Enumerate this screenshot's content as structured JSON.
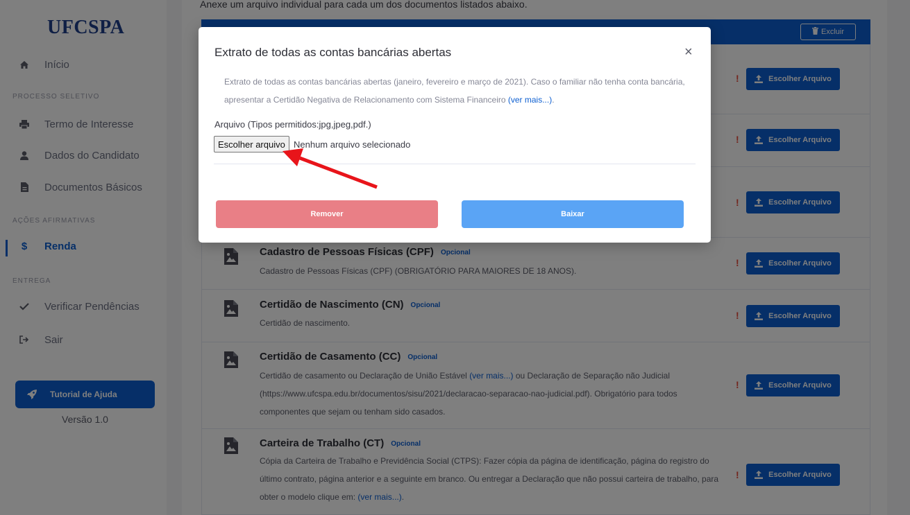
{
  "sidebar": {
    "brand": "UFCSPA",
    "home_label": "Início",
    "section_processo": "PROCESSO SELETIVO",
    "termo_label": "Termo de Interesse",
    "dados_label": "Dados do Candidato",
    "documentos_label": "Documentos Básicos",
    "section_acoes": "AÇÕES AFIRMATIVAS",
    "renda_label": "Renda",
    "section_entrega": "ENTREGA",
    "verificar_label": "Verificar Pendências",
    "sair_label": "Sair",
    "help_label": "Tutorial de Ajuda",
    "version": "Versão 1.0"
  },
  "main": {
    "intro": "Anexe um arquivo individual para cada um dos documentos listados abaixo.",
    "excluir_label": "Excluir",
    "optional_badge": "Opcional",
    "choose_label": "Escolher Arquivo",
    "warn_mark": "!",
    "docs": [
      {
        "title": "Cadastro de Pessoas Físicas (CPF)",
        "desc": "Cadastro de Pessoas Físicas (CPF) (OBRIGATÓRIO PARA MAIORES DE 18 ANOS)."
      },
      {
        "title": "Certidão de Nascimento (CN)",
        "desc": "Certidão de nascimento."
      },
      {
        "title": "Certidão de Casamento (CC)",
        "desc_a": "Certidão de casamento ou Declaração de União Estável ",
        "link": "(ver mais...)",
        "desc_b": " ou Declaração de Separação não Judicial (https://www.ufcspa.edu.br/documentos/sisu/2021/declaracao-separacao-nao-judicial.pdf). Obrigatório para todos componentes que sejam ou tenham sido casados."
      },
      {
        "title": "Carteira de Trabalho (CT)",
        "desc_a": "Cópia da Carteira de Trabalho e Previdência Social (CTPS): Fazer cópia da página de identificação, página do registro do último contrato, página anterior e a seguinte em branco. Ou entregar a Declaração que não possui carteira de trabalho, para obter o modelo clique em: ",
        "link": "(ver mais...)",
        "desc_b": "."
      }
    ]
  },
  "modal": {
    "title": "Extrato de todas as contas bancárias abertas",
    "close": "×",
    "desc_a": "Extrato de todas as contas bancárias abertas (janeiro, fevereiro e março de 2021). Caso o familiar não tenha conta bancária, apresentar a Certidão Negativa de Relacionamento com Sistema Financeiro ",
    "desc_link": "(ver mais...)",
    "desc_b": ".",
    "file_label": "Arquivo (Tipos permitidos:jpg,jpeg,pdf.)",
    "file_button": "Escolher arquivo",
    "file_status": "Nenhum arquivo selecionado",
    "remove_label": "Remover",
    "download_label": "Baixar"
  },
  "colors": {
    "primary": "#0d5fd1",
    "remove": "#e97f86",
    "download": "#5aa4f5",
    "arrow": "#e8141a",
    "warn": "#e74a3b"
  }
}
